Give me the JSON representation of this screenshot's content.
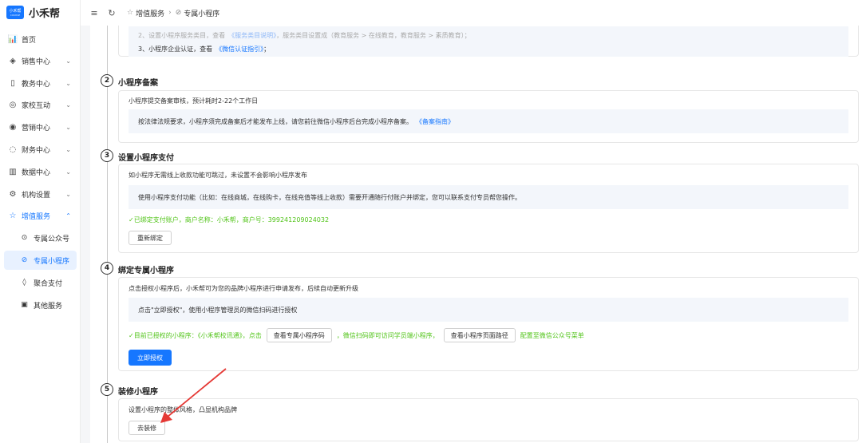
{
  "app": {
    "logo_mark": "小禾帮",
    "logo_sub": "COURSE",
    "name": "小禾帮"
  },
  "sidebar": {
    "items": [
      {
        "label": "首页",
        "icon": "chart-icon",
        "glyph": "📊"
      },
      {
        "label": "销售中心",
        "icon": "layers-icon",
        "glyph": "◈"
      },
      {
        "label": "教务中心",
        "icon": "book-icon",
        "glyph": "▯"
      },
      {
        "label": "家校互动",
        "icon": "chat-icon",
        "glyph": "◎"
      },
      {
        "label": "营销中心",
        "icon": "target-icon",
        "glyph": "◉"
      },
      {
        "label": "财务中心",
        "icon": "coin-icon",
        "glyph": "◌"
      },
      {
        "label": "数据中心",
        "icon": "bar-chart-icon",
        "glyph": "▥"
      },
      {
        "label": "机构设置",
        "icon": "gear-icon",
        "glyph": "⚙"
      },
      {
        "label": "增值服务",
        "icon": "star-icon",
        "glyph": "☆"
      }
    ],
    "sub_items": [
      {
        "label": "专属公众号",
        "icon": "official-account-icon",
        "glyph": "⊙"
      },
      {
        "label": "专属小程序",
        "icon": "mini-program-icon",
        "glyph": "⊘"
      },
      {
        "label": "聚合支付",
        "icon": "shield-icon",
        "glyph": "◊"
      },
      {
        "label": "其他服务",
        "icon": "document-icon",
        "glyph": "▣"
      }
    ]
  },
  "topbar": {
    "menu_glyph": "≡",
    "refresh_glyph": "↻",
    "crumb1": "增值服务",
    "crumb_sep": "›",
    "crumb2": "专属小程序",
    "crumb1_glyph": "☆",
    "crumb2_glyph": "⊘"
  },
  "step1": {
    "line2_prefix": "2、设置小程序服务类目，查看",
    "line2_link": "《服务类目说明》",
    "line2_suffix": "，服务类目设置成（教育服务 > 在线教育，教育服务 > 素质教育）；",
    "line3_prefix": "3、小程序企业认证，查看",
    "line3_link": "《微信认证指引》",
    "line3_suffix": "；"
  },
  "step2": {
    "num": "2",
    "title": "小程序备案",
    "desc": "小程序提交备案审核，预计耗时2-22个工作日",
    "note": "按法律法规要求，小程序须完成备案后才能发布上线，请您前往微信小程序后台完成小程序备案。",
    "note_link": "《备案指南》"
  },
  "step3": {
    "num": "3",
    "title": "设置小程序支付",
    "desc": "如小程序无需线上收款功能可跳过，未设置不会影响小程序发布",
    "note": "使用小程序支付功能（比如：在线商城，在线购卡，在线充值等线上收款）需要开通随行付账户并绑定，您可以联系支付专员帮您操作。",
    "status": "✓已绑定支付账户，商户名称：小禾帮，商户号：399241209024032",
    "rebind": "重新绑定"
  },
  "step4": {
    "num": "4",
    "title": "绑定专属小程序",
    "desc": "点击授权小程序后，小禾帮可为您的品牌小程序进行申请发布，后续自动更新升级",
    "note": "点击\"立即授权\"，使用小程序管理员的微信扫码进行授权",
    "status_prefix": "✓目前已授权的小程序：《小禾帮校讯通》，点击",
    "btn_view_code": "查看专属小程序码",
    "status_middle": "，微信扫码即可访问学员端小程序，",
    "btn_view_path": "查看小程序页面路径",
    "status_suffix": "配置至微信公众号菜单",
    "authorize": "立即授权"
  },
  "step5": {
    "num": "5",
    "title": "装修小程序",
    "desc": "设置小程序的整体风格，凸显机构品牌",
    "btn": "去装修"
  },
  "colors": {
    "accent": "#1677ff",
    "success": "#52c41a",
    "arrow": "#e53935"
  }
}
